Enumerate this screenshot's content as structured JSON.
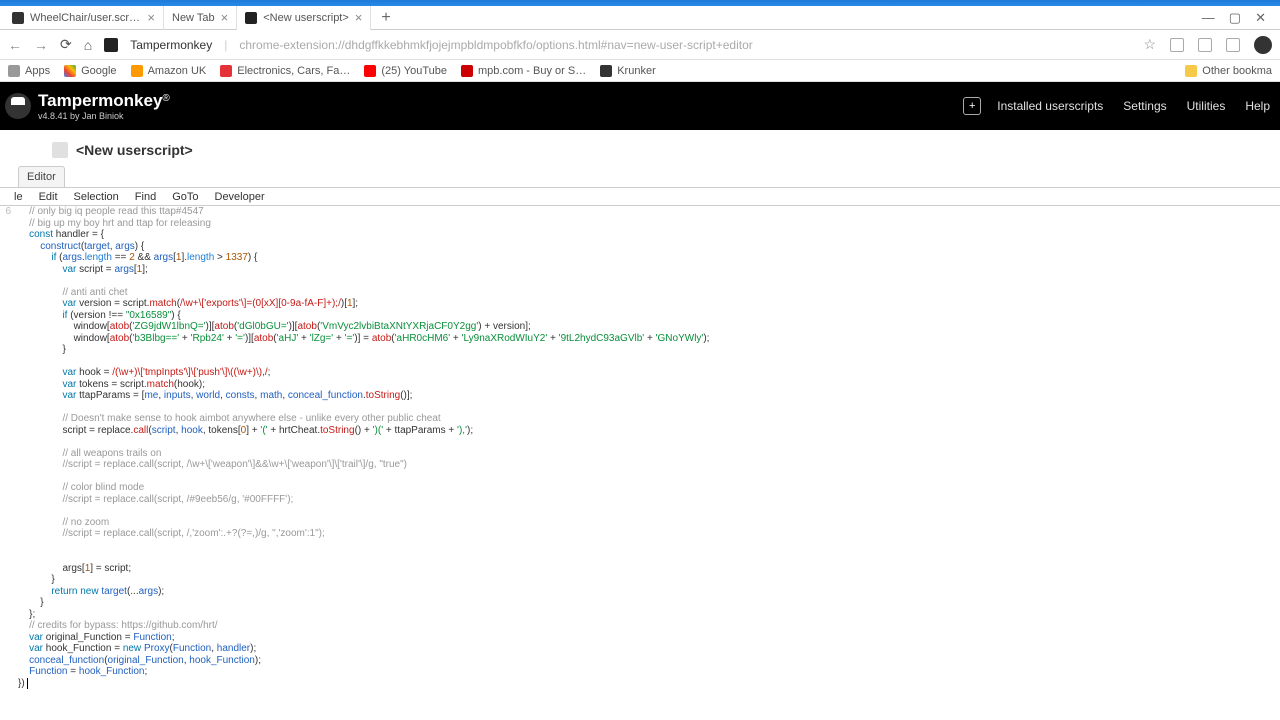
{
  "tabs": [
    {
      "title": "WheelChair/user.script.js at mas"
    },
    {
      "title": "New Tab"
    },
    {
      "title": "<New userscript>"
    }
  ],
  "newTabGlyph": "+",
  "windowControls": {
    "min": "—",
    "max": "▢",
    "close": "✕"
  },
  "addr": {
    "extName": "Tampermonkey",
    "url": "chrome-extension://dhdgffkkebhmkfjojejmpbldmpobfkfo/options.html#nav=new-user-script+editor",
    "star": "☆"
  },
  "bookmarks": {
    "apps": "Apps",
    "google": "Google",
    "amazon": "Amazon UK",
    "ebay": "Electronics, Cars, Fa…",
    "youtube": "(25) YouTube",
    "mpb": "mpb.com - Buy or S…",
    "krunker": "Krunker",
    "other": "Other bookma"
  },
  "appHeader": {
    "title": "Tampermonkey",
    "reg": "®",
    "version": "v4.8.41 by Jan Biniok",
    "boxGlyph": "+",
    "installed": "Installed userscripts",
    "settings": "Settings",
    "utilities": "Utilities",
    "help": "Help"
  },
  "pageTab": "<New userscript>",
  "subTab": "Editor",
  "editorMenu": {
    "file": "le",
    "edit": "Edit",
    "selection": "Selection",
    "find": "Find",
    "goto": "GoTo",
    "developer": "Developer"
  },
  "code": [
    {
      "n": "",
      "html": "    <span class='c-comment'>// only big iq people read this ttap#4547</span>"
    },
    {
      "n": "",
      "html": "    <span class='c-comment'>// big up my boy hrt and ttap for releasing</span>"
    },
    {
      "n": "",
      "html": "    <span class='c-kw'>const</span> handler = {"
    },
    {
      "n": "",
      "html": "        <span class='blue'>construct</span>(<span class='blue'>target</span>, <span class='blue'>args</span>) {"
    },
    {
      "n": "",
      "html": "            <span class='c-kw'>if</span> (<span class='blue'>args</span>.<span class='c-prop'>length</span> == <span class='c-num'>2</span> &amp;&amp; <span class='blue'>args</span>[<span class='c-num'>1</span>].<span class='c-prop'>length</span> &gt; <span class='c-num'>1337</span>) {"
    },
    {
      "n": "",
      "html": "                <span class='c-kw'>var</span> script = <span class='blue'>args</span>[<span class='c-num'>1</span>];"
    },
    {
      "n": "",
      "html": " "
    },
    {
      "n": "",
      "html": "                <span class='c-comment'>// anti anti chet</span>"
    },
    {
      "n": "",
      "html": "                <span class='c-kw'>var</span> version = script.<span class='c-fn'>match</span>(<span class='c-reg'>/\\w+\\['exports'\\]=(0[xX][0-9a-fA-F]+);/</span>)[<span class='c-num'>1</span>];"
    },
    {
      "n": "",
      "html": "                <span class='c-kw'>if</span> (version !== <span class='c-str'>\"0x16589\"</span>) {"
    },
    {
      "n": "",
      "html": "                    window[<span class='c-fn'>atob</span>(<span class='c-str'>'ZG9jdW1lbnQ='</span>)][<span class='c-fn'>atob</span>(<span class='c-str'>'dGl0bGU='</span>)][<span class='c-fn'>atob</span>(<span class='c-str'>'VmVyc2lvbiBtaXNtYXRjaCF0Y2gg'</span>) + version];"
    },
    {
      "n": "",
      "html": "                    window[<span class='c-fn'>atob</span>(<span class='c-str'>'b3Blbg=='</span> + <span class='c-str'>'Rpb24'</span> + <span class='c-str'>'='</span>)][<span class='c-fn'>atob</span>(<span class='c-str'>'aHJ'</span> + <span class='c-str'>'lZg='</span> + <span class='c-str'>'='</span>)] = <span class='c-fn'>atob</span>(<span class='c-str'>'aHR0cHM6'</span> + <span class='c-str'>'Ly9naXRodWIuY2'</span> + <span class='c-str'>'9tL2hydC93aGVlb'</span> + <span class='c-str'>'GNoYWly'</span>);"
    },
    {
      "n": "",
      "html": "                }"
    },
    {
      "n": "",
      "html": " "
    },
    {
      "n": "",
      "html": "                <span class='c-kw'>var</span> hook = <span class='c-reg'>/(\\w+)\\['tmpInpts'\\]\\['push'\\]\\((\\w+)\\),/</span>;"
    },
    {
      "n": "",
      "html": "                <span class='c-kw'>var</span> tokens = script.<span class='c-fn'>match</span>(hook);"
    },
    {
      "n": "",
      "html": "                <span class='c-kw'>var</span> ttapParams = [<span class='blue'>me</span>, <span class='blue'>inputs</span>, <span class='blue'>world</span>, <span class='blue'>consts</span>, <span class='blue'>math</span>, <span class='blue'>conceal_function</span>.<span class='c-fn'>toString</span>()];"
    },
    {
      "n": "",
      "html": " "
    },
    {
      "n": "",
      "html": "                <span class='c-comment'>// Doesn't make sense to hook aimbot anywhere else - unlike every other public cheat</span>"
    },
    {
      "n": "",
      "html": "                script = replace.<span class='c-fn'>call</span>(<span class='blue'>script</span>, <span class='blue'>hook</span>, tokens[<span class='c-num'>0</span>] + <span class='c-str'>'('</span> + hrtCheat.<span class='c-fn'>toString</span>() + <span class='c-str'>')('</span> + ttapParams + <span class='c-str'>'),'</span>);"
    },
    {
      "n": "",
      "html": " "
    },
    {
      "n": "",
      "html": "                <span class='c-comment'>// all weapons trails on</span>"
    },
    {
      "n": "",
      "html": "                <span class='c-comment'>//script = replace.call(script, /\\w+\\['weapon'\\]&amp;&amp;\\w+\\['weapon'\\]\\['trail'\\]/g, \"true\")</span>"
    },
    {
      "n": "",
      "html": " "
    },
    {
      "n": "",
      "html": "                <span class='c-comment'>// color blind mode</span>"
    },
    {
      "n": "",
      "html": "                <span class='c-comment'>//script = replace.call(script, /#9eeb56/g, '#00FFFF');</span>"
    },
    {
      "n": "",
      "html": " "
    },
    {
      "n": "",
      "html": "                <span class='c-comment'>// no zoom</span>"
    },
    {
      "n": "",
      "html": "                <span class='c-comment'>//script = replace.call(script, /,'zoom':.+?(?=,)/g, \",'zoom':1\");</span>"
    },
    {
      "n": "",
      "html": " "
    },
    {
      "n": "",
      "html": " "
    },
    {
      "n": "",
      "html": "                args[<span class='c-num'>1</span>] = script;"
    },
    {
      "n": "",
      "html": "            }"
    },
    {
      "n": "",
      "html": "            <span class='c-kw'>return new</span> <span class='blue'>target</span>(...<span class='blue'>args</span>);"
    },
    {
      "n": "",
      "html": "        }"
    },
    {
      "n": "",
      "html": "    };"
    },
    {
      "n": "",
      "html": "    <span class='c-comment'>// credits for bypass: https://github.com/hrt/</span>"
    },
    {
      "n": "",
      "html": "    <span class='c-kw'>var</span> original_Function = <span class='blue'>Function</span>;"
    },
    {
      "n": "",
      "html": "    <span class='c-kw'>var</span> hook_Function = <span class='c-kw'>new</span> <span class='blue'>Proxy</span>(<span class='blue'>Function</span>, <span class='blue'>handler</span>);"
    },
    {
      "n": "",
      "html": "    <span class='blue'>conceal_function</span>(<span class='blue'>original_Function</span>, <span class='blue'>hook_Function</span>);"
    },
    {
      "n": "",
      "html": "    <span class='blue'>Function</span> = <span class='blue'>hook_Function</span>;"
    },
    {
      "n": "6",
      "html": "}) <span class='cursor'></span>"
    }
  ]
}
